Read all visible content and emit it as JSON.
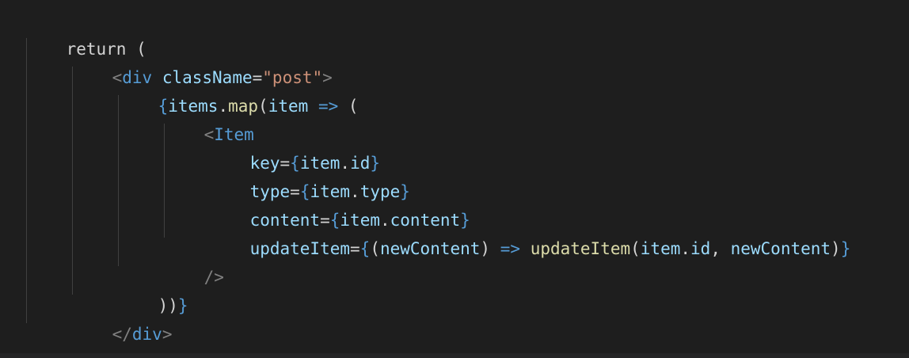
{
  "editor": {
    "theme": {
      "background": "#1e1e1e",
      "tag_color": "#569cd6",
      "attribute_color": "#9cdcfe",
      "string_color": "#ce9178",
      "function_color": "#dcdcaa",
      "guide_color": "#404040"
    },
    "lines": [
      {
        "tokens": [
          "return",
          " ("
        ]
      },
      {
        "tokens": [
          "<",
          "div",
          " ",
          "className",
          "=",
          "\"post\"",
          ">"
        ]
      },
      {
        "tokens": [
          "{",
          "items",
          ".",
          "map",
          "(",
          "item",
          " ",
          "=>",
          " ("
        ]
      },
      {
        "tokens": [
          "<",
          "Item"
        ]
      },
      {
        "tokens": [
          "key",
          "=",
          "{",
          "item",
          ".",
          "id",
          "}"
        ]
      },
      {
        "tokens": [
          "type",
          "=",
          "{",
          "item",
          ".",
          "type",
          "}"
        ]
      },
      {
        "tokens": [
          "content",
          "=",
          "{",
          "item",
          ".",
          "content",
          "}"
        ]
      },
      {
        "tokens": [
          "updateItem",
          "=",
          "{",
          "(",
          "newContent",
          ")",
          " ",
          "=>",
          " ",
          "updateItem",
          "(",
          "item",
          ".",
          "id",
          ", ",
          "newContent",
          ")",
          "}"
        ]
      },
      {
        "tokens": [
          "/>"
        ]
      },
      {
        "tokens": [
          ")",
          ")",
          "}"
        ]
      },
      {
        "tokens": [
          "</",
          "div",
          ">"
        ]
      },
      {
        "tokens": [
          ");"
        ]
      }
    ]
  }
}
